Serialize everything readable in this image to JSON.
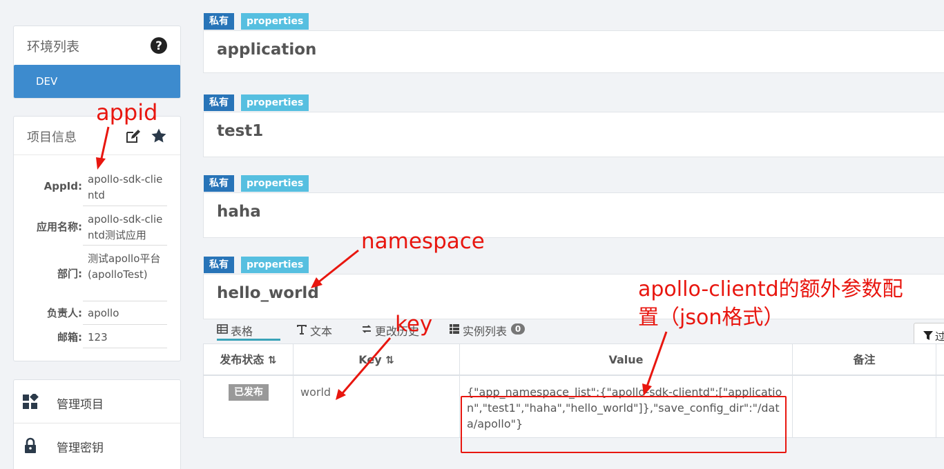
{
  "sidebar": {
    "env_panel": {
      "title": "环境列表",
      "environments": [
        {
          "label": "DEV"
        }
      ]
    },
    "info_panel": {
      "title": "项目信息",
      "rows": [
        {
          "label": "AppId:",
          "value": "apollo-sdk-clientd"
        },
        {
          "label": "应用名称:",
          "value": "apollo-sdk-clientd测试应用"
        },
        {
          "label": "部门:",
          "value": "测试apollo平台(apolloTest)"
        },
        {
          "label": "负责人:",
          "value": "apollo"
        },
        {
          "label": "邮箱:",
          "value": "123"
        }
      ]
    },
    "menu": [
      {
        "label": "管理项目"
      },
      {
        "label": "管理密钥"
      }
    ]
  },
  "namespaces": [
    {
      "scope": "私有",
      "format": "properties",
      "name": "application"
    },
    {
      "scope": "私有",
      "format": "properties",
      "name": "test1"
    },
    {
      "scope": "私有",
      "format": "properties",
      "name": "haha"
    },
    {
      "scope": "私有",
      "format": "properties",
      "name": "hello_world"
    }
  ],
  "tabs": [
    {
      "label": "表格"
    },
    {
      "label": "文本"
    },
    {
      "label": "更改历史"
    },
    {
      "label": "实例列表",
      "count": "0"
    }
  ],
  "filter_button": {
    "label": "过"
  },
  "table": {
    "headers": [
      "发布状态",
      "Key",
      "Value",
      "备注"
    ],
    "rows": [
      {
        "status": "已发布",
        "key": "world",
        "value": "{\"app_namespace_list\":{\"apollo-sdk-clientd\":[\"application\",\"test1\",\"haha\",\"hello_world\"]},\"save_config_dir\":\"/data/apollo\"}",
        "comment": ""
      }
    ]
  },
  "annotations": {
    "appid": "appid",
    "namespace": "namespace",
    "key": "key",
    "extra_line1": "apollo-clientd的额外参数配",
    "extra_line2": "置（json格式）"
  },
  "colors": {
    "accent": "#3d8bce",
    "badge_private": "#2874b8",
    "badge_format": "#56bfe0",
    "annotation_red": "#e8160f",
    "status_badge": "#999999"
  },
  "icons": [
    "question-circle-icon",
    "edit-icon",
    "star-icon",
    "dashboard-icon",
    "lock-icon",
    "table-icon",
    "text-icon",
    "history-icon",
    "instances-icon",
    "filter-icon"
  ]
}
